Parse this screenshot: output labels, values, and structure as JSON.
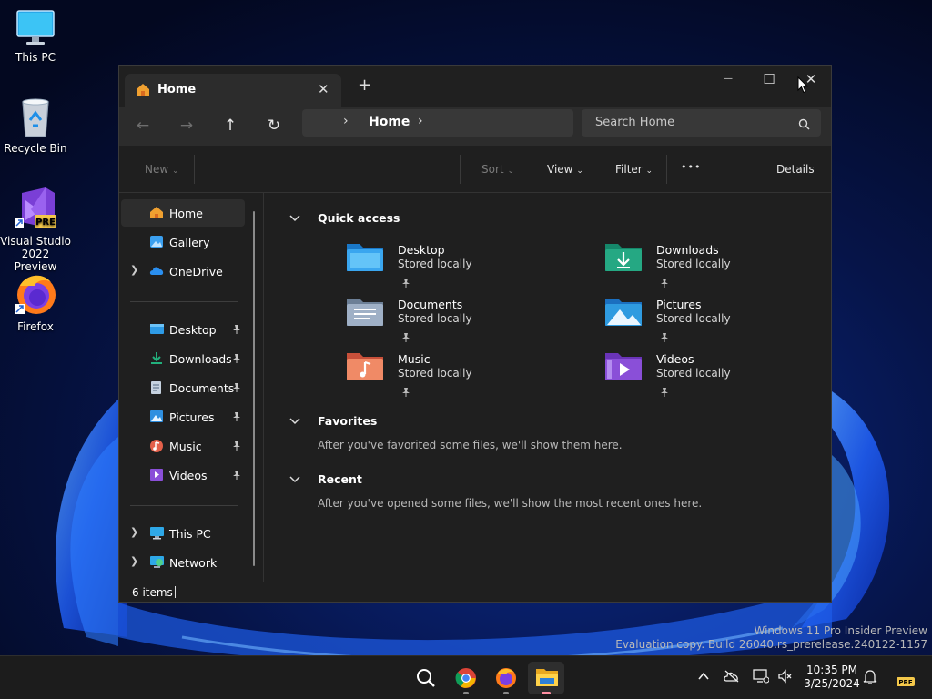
{
  "desktop": {
    "icons": [
      {
        "label": "This PC"
      },
      {
        "label": "Recycle Bin"
      },
      {
        "label": "Visual Studio 2022 Preview",
        "badge": "PRE"
      },
      {
        "label": "Firefox"
      }
    ],
    "watermark": {
      "line1": "Windows 11 Pro Insider Preview",
      "line2": "Evaluation copy. Build 26040.rs_prerelease.240122-1157"
    }
  },
  "explorer": {
    "tab": {
      "title": "Home",
      "icon": "home-icon"
    },
    "new_tab": "+",
    "window_controls": {
      "minimize": "—",
      "maximize": "☐",
      "close": "✕"
    },
    "address": {
      "location": "Home"
    },
    "search": {
      "placeholder": "Search Home"
    },
    "commands": {
      "new": "New",
      "sort": "Sort",
      "view": "View",
      "filter": "Filter",
      "more": "•••",
      "details": "Details"
    },
    "sidebar": {
      "top": [
        {
          "label": "Home",
          "icon": "home-icon",
          "selected": true
        },
        {
          "label": "Gallery",
          "icon": "gallery-icon"
        },
        {
          "label": "OneDrive",
          "icon": "cloud-icon",
          "expandable": true
        }
      ],
      "pinned": [
        {
          "label": "Desktop",
          "icon": "desktop-folder-icon"
        },
        {
          "label": "Downloads",
          "icon": "download-icon"
        },
        {
          "label": "Documents",
          "icon": "documents-icon"
        },
        {
          "label": "Pictures",
          "icon": "pictures-icon"
        },
        {
          "label": "Music",
          "icon": "music-icon"
        },
        {
          "label": "Videos",
          "icon": "videos-icon"
        }
      ],
      "bottom": [
        {
          "label": "This PC",
          "icon": "computer-icon",
          "expandable": true
        },
        {
          "label": "Network",
          "icon": "network-icon",
          "expandable": true
        }
      ]
    },
    "sections": {
      "quick_access": {
        "title": "Quick access",
        "items": [
          {
            "name": "Desktop",
            "status": "Stored locally",
            "color": "#3a9ee8"
          },
          {
            "name": "Downloads",
            "status": "Stored locally",
            "color": "#25a883"
          },
          {
            "name": "Documents",
            "status": "Stored locally",
            "color": "#8c9fb8"
          },
          {
            "name": "Pictures",
            "status": "Stored locally",
            "color": "#2f9be0"
          },
          {
            "name": "Music",
            "status": "Stored locally",
            "color": "#e86e50"
          },
          {
            "name": "Videos",
            "status": "Stored locally",
            "color": "#8a4fd8"
          }
        ]
      },
      "favorites": {
        "title": "Favorites",
        "empty": "After you've favorited some files, we'll show them here."
      },
      "recent": {
        "title": "Recent",
        "empty": "After you've opened some files, we'll show the most recent ones here."
      }
    },
    "status": {
      "items": "6 items"
    }
  },
  "taskbar": {
    "apps": [
      "search-icon",
      "chrome-icon",
      "firefox-icon",
      "file-explorer-icon"
    ],
    "clock": {
      "time": "10:35 PM",
      "date": "3/25/2024"
    },
    "tray_badge": "PRE"
  }
}
